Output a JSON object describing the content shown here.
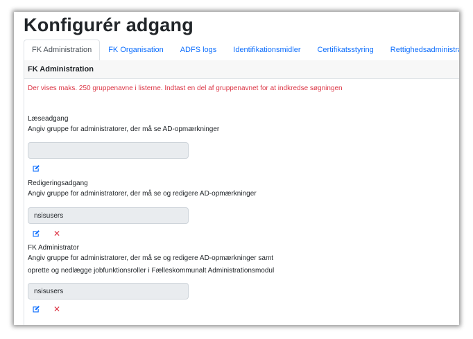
{
  "page": {
    "title": "Konfigurér adgang"
  },
  "tabs": [
    {
      "label": "FK Administration",
      "active": true
    },
    {
      "label": "FK Organisation"
    },
    {
      "label": "ADFS logs"
    },
    {
      "label": "Identifikationsmidler"
    },
    {
      "label": "Certifikatsstyring"
    },
    {
      "label": "Rettighedsadministration"
    }
  ],
  "card": {
    "header": "FK Administration",
    "notice": "Der vises maks. 250 gruppenavne i listerne. Indtast en del af gruppenavnet for at indkredse søgningen"
  },
  "sections": [
    {
      "label": "Læseadgang",
      "description": "Angiv gruppe for administratorer, der må se AD-opmærkninger",
      "value": ""
    },
    {
      "label": "Redigeringsadgang",
      "description": "Angiv gruppe for administratorer, der må se og redigere AD-opmærkninger",
      "value": "nsisusers"
    },
    {
      "label": "FK Administrator",
      "description_line1": "Angiv gruppe for administratorer, der må se og redigere AD-opmærkninger samt",
      "description_line2": "oprette og nedlægge jobfunktionsroller i Fælleskommunalt Administrationsmodul",
      "value": "nsisusers"
    }
  ],
  "icons": {
    "edit": "edit-icon",
    "delete": "delete-icon"
  },
  "colors": {
    "link": "#0d6efd",
    "danger": "#dc3545",
    "field_bg": "#e9ecef"
  }
}
